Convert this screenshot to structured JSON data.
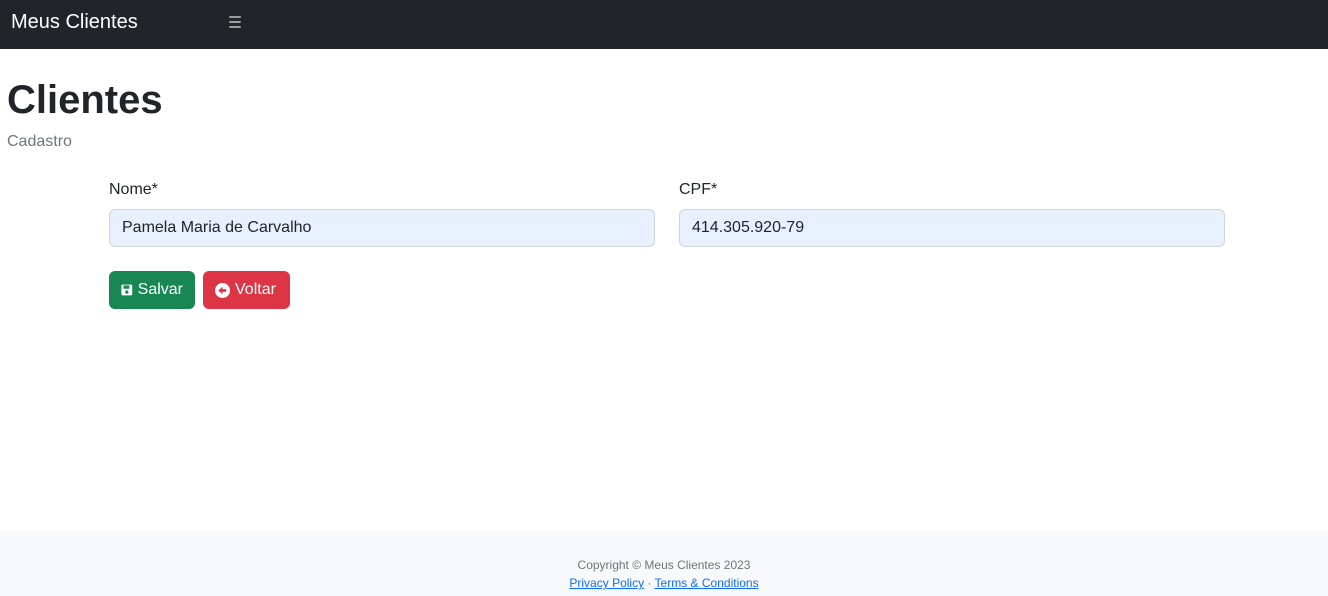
{
  "navbar": {
    "brand": "Meus Clientes",
    "menu_icon": "menu-icon"
  },
  "page": {
    "title": "Clientes",
    "subtitle": "Cadastro"
  },
  "form": {
    "nome": {
      "label": "Nome*",
      "value": "Pamela Maria de Carvalho"
    },
    "cpf": {
      "label": "CPF*",
      "value": "414.305.920-79"
    }
  },
  "actions": {
    "save_label": "Salvar",
    "save_icon": "save-icon",
    "back_label": "Voltar",
    "back_icon": "arrow-circle-left-icon"
  },
  "footer": {
    "copyright": "Copyright © Meus Clientes 2023",
    "privacy_label": "Privacy Policy",
    "separator": "·",
    "terms_label": "Terms & Conditions"
  },
  "colors": {
    "navbar_bg": "#212529",
    "save_button": "#198754",
    "back_button": "#dc3545",
    "autofill_bg": "#e8f0fe",
    "footer_bg": "#f8f9fa",
    "link": "#0d6efd"
  }
}
